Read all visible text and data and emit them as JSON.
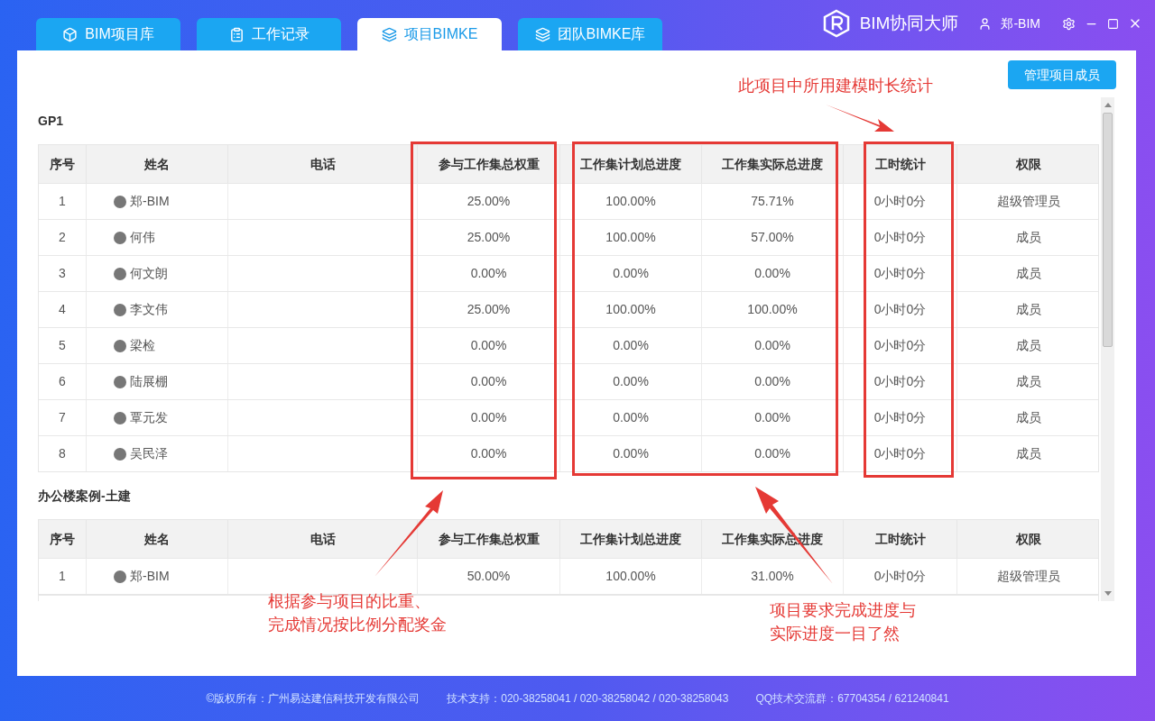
{
  "tabs": [
    {
      "label": "BIM项目库",
      "selected": false
    },
    {
      "label": "工作记录",
      "selected": false
    },
    {
      "label": "项目BIMKE",
      "selected": true
    },
    {
      "label": "团队BIMKE库",
      "selected": false
    }
  ],
  "app_title": "BIM协同大师",
  "user": "郑-BIM",
  "manage_button": "管理项目成员",
  "sections": [
    {
      "title": "GP1",
      "columns": [
        "序号",
        "姓名",
        "电话",
        "参与工作集总权重",
        "工作集计划总进度",
        "工作集实际总进度",
        "工时统计",
        "权限"
      ],
      "rows": [
        [
          "1",
          "郑-BIM",
          "",
          "25.00%",
          "100.00%",
          "75.71%",
          "0小时0分",
          "超级管理员"
        ],
        [
          "2",
          "何伟",
          "",
          "25.00%",
          "100.00%",
          "57.00%",
          "0小时0分",
          "成员"
        ],
        [
          "3",
          "何文朗",
          "",
          "0.00%",
          "0.00%",
          "0.00%",
          "0小时0分",
          "成员"
        ],
        [
          "4",
          "李文伟",
          "",
          "25.00%",
          "100.00%",
          "100.00%",
          "0小时0分",
          "成员"
        ],
        [
          "5",
          "梁检",
          "",
          "0.00%",
          "0.00%",
          "0.00%",
          "0小时0分",
          "成员"
        ],
        [
          "6",
          "陆展棚",
          "",
          "0.00%",
          "0.00%",
          "0.00%",
          "0小时0分",
          "成员"
        ],
        [
          "7",
          "覃元发",
          "",
          "0.00%",
          "0.00%",
          "0.00%",
          "0小时0分",
          "成员"
        ],
        [
          "8",
          "吴民泽",
          "",
          "0.00%",
          "0.00%",
          "0.00%",
          "0小时0分",
          "成员"
        ]
      ]
    },
    {
      "title": "办公楼案例-土建",
      "columns": [
        "序号",
        "姓名",
        "电话",
        "参与工作集总权重",
        "工作集计划总进度",
        "工作集实际总进度",
        "工时统计",
        "权限"
      ],
      "rows": [
        [
          "1",
          "郑-BIM",
          "",
          "50.00%",
          "100.00%",
          "31.00%",
          "0小时0分",
          "超级管理员"
        ]
      ]
    }
  ],
  "annotations": [
    [
      "此项目中所用建模时长统计"
    ],
    [
      "根据参与项目的比重、",
      "完成情况按比例分配奖金"
    ],
    [
      "项目要求完成进度与",
      "实际进度一目了然"
    ]
  ],
  "footer": [
    "©版权所有：广州易达建信科技开发有限公司",
    "技术支持：020-38258041 / 020-38258042 / 020-38258043",
    "QQ技术交流群：67704354 / 621240841"
  ]
}
